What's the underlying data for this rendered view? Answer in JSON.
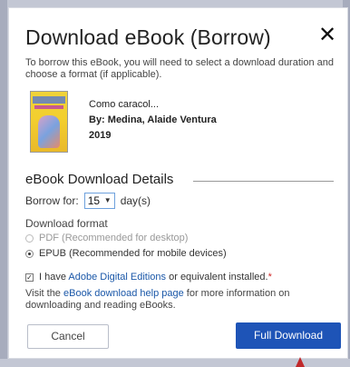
{
  "dialog": {
    "title": "Download eBook (Borrow)",
    "close_label": "✕",
    "intro": "To borrow this eBook, you will need to select a download duration and choose a format (if applicable)."
  },
  "book": {
    "title": "Como caracol...",
    "author": "By: Medina, Alaide Ventura",
    "year": "2019"
  },
  "details": {
    "section_title": "eBook Download Details",
    "borrow_label": "Borrow for:",
    "borrow_value": "15",
    "borrow_unit": "day(s)",
    "format_label": "Download format",
    "formats": [
      {
        "label": "PDF (Recommended for desktop)",
        "selected": false,
        "enabled": false
      },
      {
        "label": "EPUB (Recommended for mobile devices)",
        "selected": true,
        "enabled": true
      }
    ]
  },
  "agreement": {
    "checked": true,
    "prefix": "I have ",
    "link_text": "Adobe Digital Editions",
    "suffix": " or equivalent installed.",
    "required_mark": "*"
  },
  "help": {
    "prefix": "Visit the ",
    "link_text": "eBook download help page",
    "suffix": " for more information on downloading and reading eBooks."
  },
  "buttons": {
    "cancel": "Cancel",
    "full_download": "Full Download"
  },
  "colors": {
    "primary_button": "#1e54b7",
    "link": "#1a57a8",
    "required": "#d02a2a",
    "arrow": "#c0282a"
  }
}
